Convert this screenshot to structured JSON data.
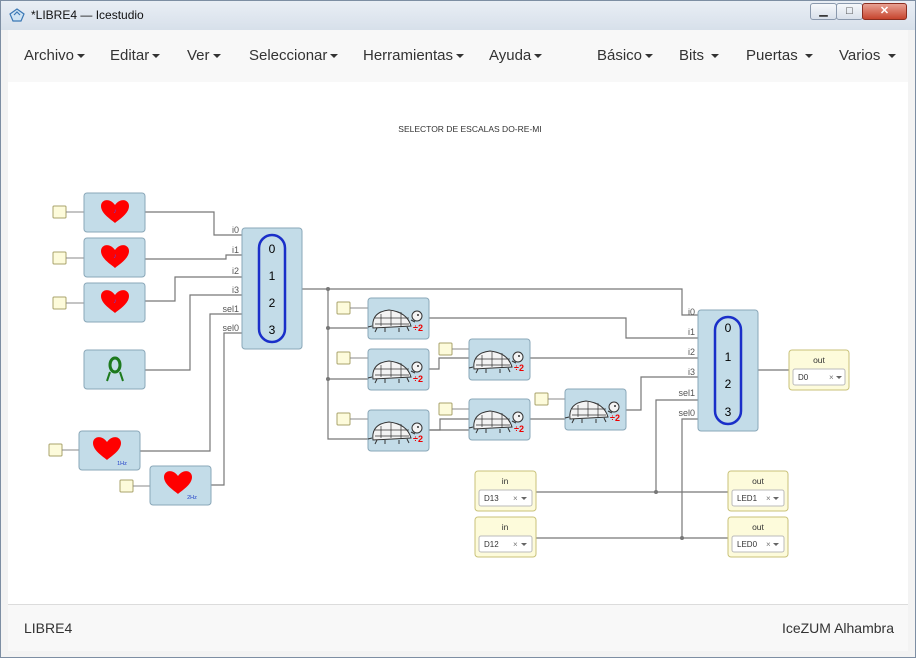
{
  "window": {
    "title": "*LIBRE4 — Icestudio"
  },
  "menus": [
    "Archivo",
    "Editar",
    "Ver",
    "Seleccionar",
    "Herramientas",
    "Ayuda",
    "Básico",
    "Bits",
    "Puertas",
    "Varios"
  ],
  "canvas": {
    "comment": "SELECTOR DE ESCALAS DO-RE-MI",
    "mux1": {
      "inputs": [
        "i0",
        "i1",
        "i2",
        "i3",
        "sel1",
        "sel0"
      ],
      "numbers": [
        "0",
        "1",
        "2",
        "3"
      ]
    },
    "mux2": {
      "inputs": [
        "i0",
        "i1",
        "i2",
        "i3",
        "sel1",
        "sel0"
      ],
      "numbers": [
        "0",
        "1",
        "2",
        "3"
      ]
    },
    "heart_labels": {
      "clk1": "1Hz",
      "clk2": "2Hz"
    },
    "divider_label": "÷2",
    "output_d0": {
      "title": "out",
      "pin": "D0"
    },
    "input_d13": {
      "title": "in",
      "pin": "D13"
    },
    "input_d12": {
      "title": "in",
      "pin": "D12"
    },
    "output_led1": {
      "title": "out",
      "pin": "LED1"
    },
    "output_led0": {
      "title": "out",
      "pin": "LED0"
    },
    "clear_glyph": "×",
    "colors": {
      "block_fill": "#c3dce8",
      "block_stroke": "#8aa7b8",
      "io_fill": "#fdfbdb",
      "io_stroke": "#c9c27a",
      "heart": "#ff0000",
      "wire": "#777777",
      "mux_ring": "#1a2fc9"
    }
  },
  "status": {
    "left": "LIBRE4",
    "right": "IceZUM Alhambra"
  }
}
